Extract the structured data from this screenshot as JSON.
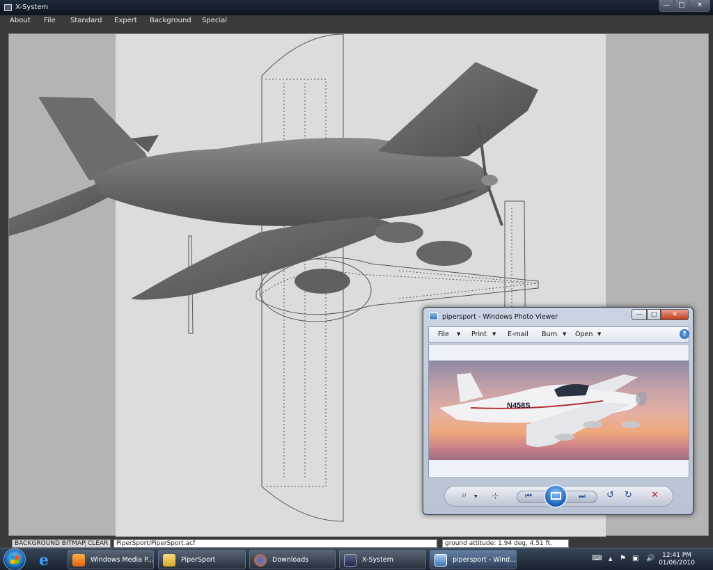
{
  "xsystem": {
    "title": "X-System",
    "window_buttons": {
      "minimize": "—",
      "maximize": "□",
      "close": "✕"
    },
    "menu": [
      "About",
      "File",
      "Standard",
      "Expert",
      "Background",
      "Special"
    ],
    "status": {
      "background_bitmap": "BACKGROUND BITMAP",
      "clear": "CLEAR",
      "file_path": "PiperSport/PiperSport.acf",
      "ground_attitude": "ground attitude: 1.94 deg, 4.51 ft."
    },
    "colors": {
      "viewport_bg": "#b4b4b4",
      "bitmap_bg": "#dcdcdc",
      "model": "#6e6e6e"
    }
  },
  "photo_viewer": {
    "title": "pipersport - Windows Photo Viewer",
    "menu": [
      "File",
      "Print",
      "E-mail",
      "Burn",
      "Open"
    ],
    "help": "?",
    "aircraft_registration": "N458S",
    "toolbar_icons": [
      "zoom-icon",
      "actual-size-icon",
      "previous-icon",
      "slideshow-icon",
      "next-icon",
      "rotate-left-icon",
      "rotate-right-icon",
      "delete-icon"
    ]
  },
  "taskbar": {
    "tasks": [
      {
        "label": "Windows Media P...",
        "icon": "media-player-icon"
      },
      {
        "label": "PiperSport",
        "icon": "folder-icon"
      },
      {
        "label": "Downloads",
        "icon": "firefox-icon"
      },
      {
        "label": "X-System",
        "icon": "xsystem-icon"
      },
      {
        "label": "pipersport - Wind...",
        "icon": "photo-viewer-icon"
      }
    ],
    "clock": {
      "time": "12:41 PM",
      "date": "01/06/2010"
    }
  }
}
